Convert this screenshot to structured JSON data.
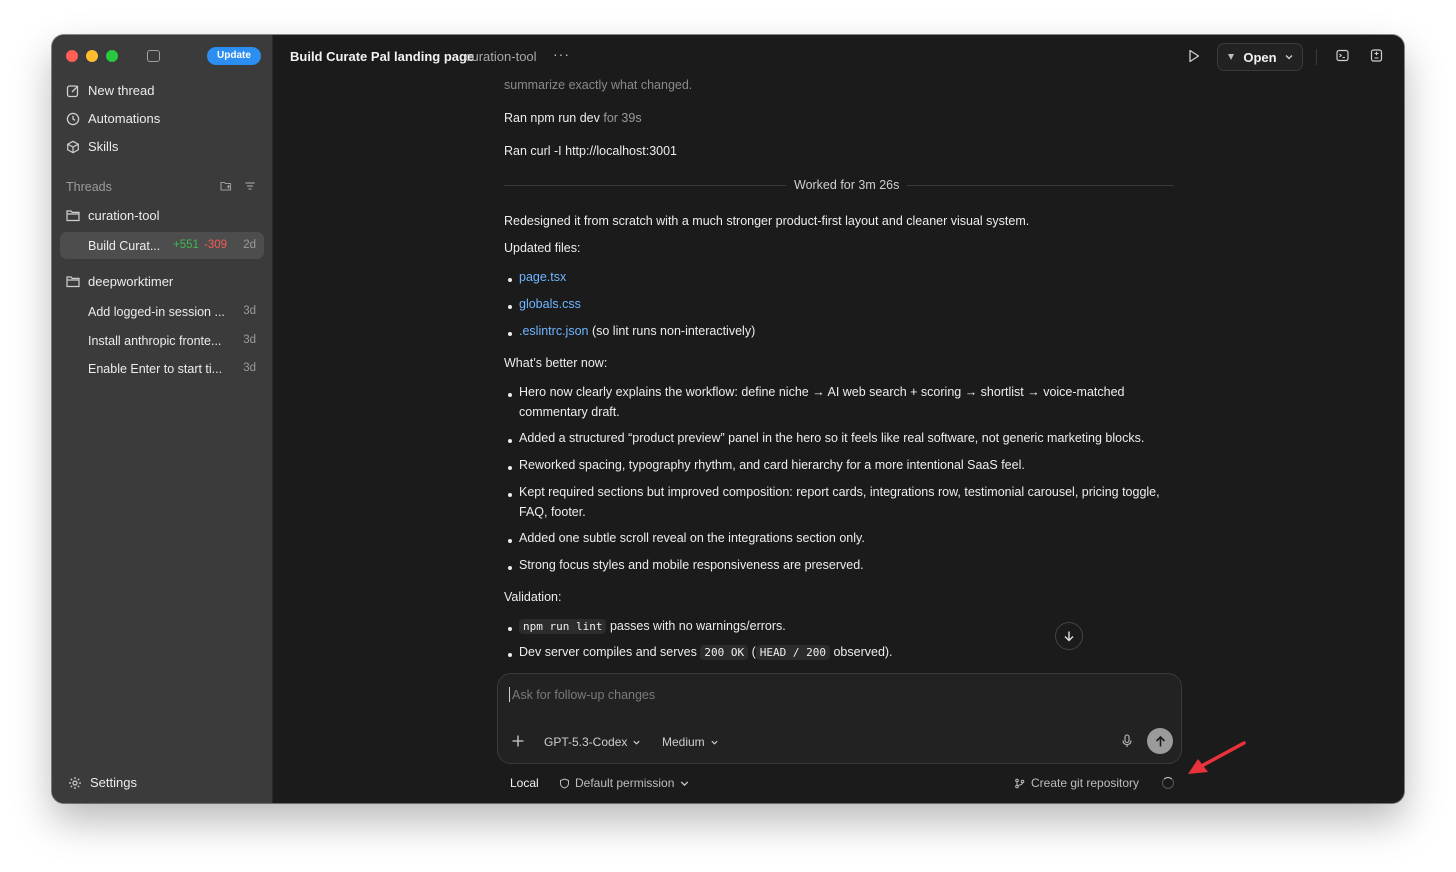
{
  "sidebar": {
    "update_label": "Update",
    "nav": [
      {
        "label": "New thread",
        "icon": "compose-icon"
      },
      {
        "label": "Automations",
        "icon": "clock-icon"
      },
      {
        "label": "Skills",
        "icon": "cube-icon"
      }
    ],
    "threads_label": "Threads",
    "projects": [
      {
        "name": "curation-tool",
        "threads": [
          {
            "title": "Build Curat...",
            "added": "+551",
            "removed": "-309",
            "age": "2d",
            "active": true
          }
        ]
      },
      {
        "name": "deepworktimer",
        "threads": [
          {
            "title": "Add logged-in session ...",
            "age": "3d"
          },
          {
            "title": "Install anthropic fronte...",
            "age": "3d"
          },
          {
            "title": "Enable Enter to start ti...",
            "age": "3d"
          }
        ]
      }
    ],
    "settings_label": "Settings"
  },
  "header": {
    "title": "Build Curate Pal landing page",
    "project": "curation-tool",
    "more": "···",
    "open_label": "Open"
  },
  "conversation": {
    "faded_line": "summarize exactly what changed.",
    "run1_prefix": "Ran npm run dev",
    "run1_suffix": "for 39s",
    "run2": "Ran curl -I http://localhost:3001",
    "worked_for": "Worked for 3m 26s",
    "intro": "Redesigned it from scratch with a much stronger product-first layout and cleaner visual system.",
    "updated_files_label": "Updated files:",
    "files": [
      {
        "name": "page.tsx",
        "note": ""
      },
      {
        "name": "globals.css",
        "note": ""
      },
      {
        "name": ".eslintrc.json",
        "note": "(so lint runs non-interactively)"
      }
    ],
    "better_label": "What’s better now:",
    "improvements": [
      "Hero now clearly explains the workflow: define niche → AI web search + scoring → shortlist → voice-matched commentary draft.",
      "Added a structured “product preview” panel in the hero so it feels like real software, not generic marketing blocks.",
      "Reworked spacing, typography rhythm, and card hierarchy for a more intentional SaaS feel.",
      "Kept required sections but improved composition: report cards, integrations row, testimonial carousel, pricing toggle, FAQ, footer.",
      "Added one subtle scroll reveal on the integrations section only.",
      "Strong focus styles and mobile responsiveness are preserved."
    ],
    "validation_label": "Validation:",
    "validation": {
      "lint_code": "npm run lint",
      "lint_text": "passes with no warnings/errors.",
      "dev_prefix": "Dev server compiles and serves",
      "dev_code1": "200 OK",
      "dev_mid": "(",
      "dev_code2": "HEAD / 200",
      "dev_suffix": "observed)."
    }
  },
  "composer": {
    "placeholder": "Ask for follow-up changes",
    "model": "GPT-5.3-Codex",
    "effort": "Medium"
  },
  "footer": {
    "local": "Local",
    "permission": "Default permission",
    "git": "Create git repository"
  },
  "colors": {
    "accent": "#2b8ef0",
    "added": "#3fb950",
    "removed": "#f25c54",
    "link": "#6fb5ff",
    "annotation": "#e8323c"
  }
}
